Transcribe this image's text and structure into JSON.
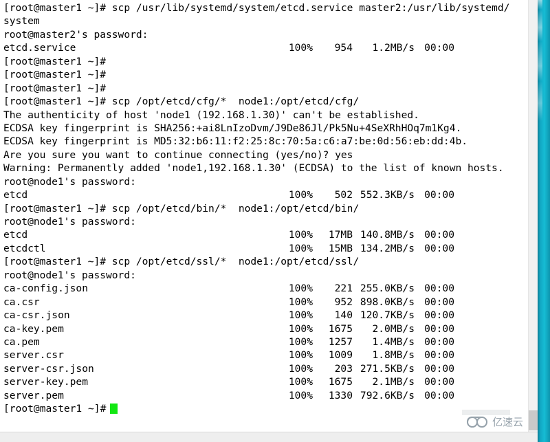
{
  "terminal": {
    "prompt_master1": "[root@master1 ~]#",
    "prompt_node1_password": "root@node1's password:",
    "prompt_master2_password": "root@master2's password:",
    "cursor_color": "#12e712",
    "lines": [
      {
        "type": "text",
        "text": "[root@master1 ~]# scp /usr/lib/systemd/system/etcd.service master2:/usr/lib/systemd/"
      },
      {
        "type": "text",
        "text": "system"
      },
      {
        "type": "text",
        "text": "root@master2's password:"
      },
      {
        "type": "xfer",
        "name": "etcd.service",
        "pct": "100%",
        "size": "954",
        "rate": "1.2MB/s",
        "eta": "00:00"
      },
      {
        "type": "text",
        "text": "[root@master1 ~]#"
      },
      {
        "type": "text",
        "text": "[root@master1 ~]#"
      },
      {
        "type": "text",
        "text": "[root@master1 ~]#"
      },
      {
        "type": "text",
        "text": "[root@master1 ~]# scp /opt/etcd/cfg/*  node1:/opt/etcd/cfg/"
      },
      {
        "type": "text",
        "text": "The authenticity of host 'node1 (192.168.1.30)' can't be established."
      },
      {
        "type": "text",
        "text": "ECDSA key fingerprint is SHA256:+ai8LnIzoDvm/J9De86Jl/Pk5Nu+4SeXRhHOq7m1Kg4."
      },
      {
        "type": "text",
        "text": "ECDSA key fingerprint is MD5:32:b6:11:f2:25:8c:70:5a:c6:a7:be:0d:56:eb:dd:4b."
      },
      {
        "type": "text",
        "text": "Are you sure you want to continue connecting (yes/no)? yes"
      },
      {
        "type": "text",
        "text": "Warning: Permanently added 'node1,192.168.1.30' (ECDSA) to the list of known hosts."
      },
      {
        "type": "text",
        "text": "root@node1's password:"
      },
      {
        "type": "xfer",
        "name": "etcd",
        "pct": "100%",
        "size": "502",
        "rate": "552.3KB/s",
        "eta": "00:00"
      },
      {
        "type": "text",
        "text": "[root@master1 ~]# scp /opt/etcd/bin/*  node1:/opt/etcd/bin/"
      },
      {
        "type": "text",
        "text": "root@node1's password:"
      },
      {
        "type": "xfer",
        "name": "etcd",
        "pct": "100%",
        "size": "17MB",
        "rate": "140.8MB/s",
        "eta": "00:00"
      },
      {
        "type": "xfer",
        "name": "etcdctl",
        "pct": "100%",
        "size": "15MB",
        "rate": "134.2MB/s",
        "eta": "00:00"
      },
      {
        "type": "text",
        "text": "[root@master1 ~]# scp /opt/etcd/ssl/*  node1:/opt/etcd/ssl/"
      },
      {
        "type": "text",
        "text": "root@node1's password:"
      },
      {
        "type": "xfer",
        "name": "ca-config.json",
        "pct": "100%",
        "size": "221",
        "rate": "255.0KB/s",
        "eta": "00:00"
      },
      {
        "type": "xfer",
        "name": "ca.csr",
        "pct": "100%",
        "size": "952",
        "rate": "898.0KB/s",
        "eta": "00:00"
      },
      {
        "type": "xfer",
        "name": "ca-csr.json",
        "pct": "100%",
        "size": "140",
        "rate": "120.7KB/s",
        "eta": "00:00"
      },
      {
        "type": "xfer",
        "name": "ca-key.pem",
        "pct": "100%",
        "size": "1675",
        "rate": "2.0MB/s",
        "eta": "00:00"
      },
      {
        "type": "xfer",
        "name": "ca.pem",
        "pct": "100%",
        "size": "1257",
        "rate": "1.4MB/s",
        "eta": "00:00"
      },
      {
        "type": "xfer",
        "name": "server.csr",
        "pct": "100%",
        "size": "1009",
        "rate": "1.8MB/s",
        "eta": "00:00"
      },
      {
        "type": "xfer",
        "name": "server-csr.json",
        "pct": "100%",
        "size": "203",
        "rate": "271.5KB/s",
        "eta": "00:00"
      },
      {
        "type": "xfer",
        "name": "server-key.pem",
        "pct": "100%",
        "size": "1675",
        "rate": "2.1MB/s",
        "eta": "00:00"
      },
      {
        "type": "xfer",
        "name": "server.pem",
        "pct": "100%",
        "size": "1330",
        "rate": "792.6KB/s",
        "eta": "00:00"
      },
      {
        "type": "prompt",
        "text": "[root@master1 ~]#"
      }
    ]
  },
  "watermark": {
    "text": "亿速云",
    "color": "#6f7f8c"
  },
  "chrome": {
    "edge_band_color": "#16bcd4",
    "scrollbar_track_color": "#f1f1f1",
    "scrollbar_thumb_color": "#c9c9c9"
  }
}
